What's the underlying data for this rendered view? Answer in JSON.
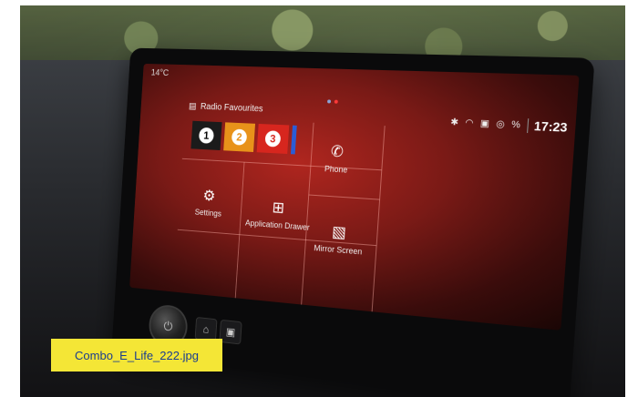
{
  "status": {
    "temperature": "14°C",
    "time": "17:23",
    "signal_text": "%"
  },
  "radio": {
    "title": "Radio Favourites",
    "stations": [
      {
        "label": "1",
        "color": "#1b1b1b"
      },
      {
        "label": "2",
        "color": "#e8921a"
      },
      {
        "label": "3",
        "color": "#d7261e"
      }
    ]
  },
  "apps": {
    "phone": "Phone",
    "settings": "Settings",
    "application_drawer": "Application Drawer",
    "mirror_screen": "Mirror Screen"
  },
  "icons": {
    "radio": "radio-icon",
    "phone": "phone-icon",
    "settings": "gear-icon",
    "app_drawer": "grid-icon",
    "mirror": "mirror-screen-icon",
    "bluetooth": "bluetooth-icon",
    "wifi": "wifi-icon",
    "car": "car-icon",
    "location": "location-icon"
  },
  "caption": "Combo_E_Life_222.jpg",
  "colors": {
    "screen_accent": "#b0261f",
    "caption_bg": "#f4e636",
    "caption_text": "#1a3d8f"
  }
}
